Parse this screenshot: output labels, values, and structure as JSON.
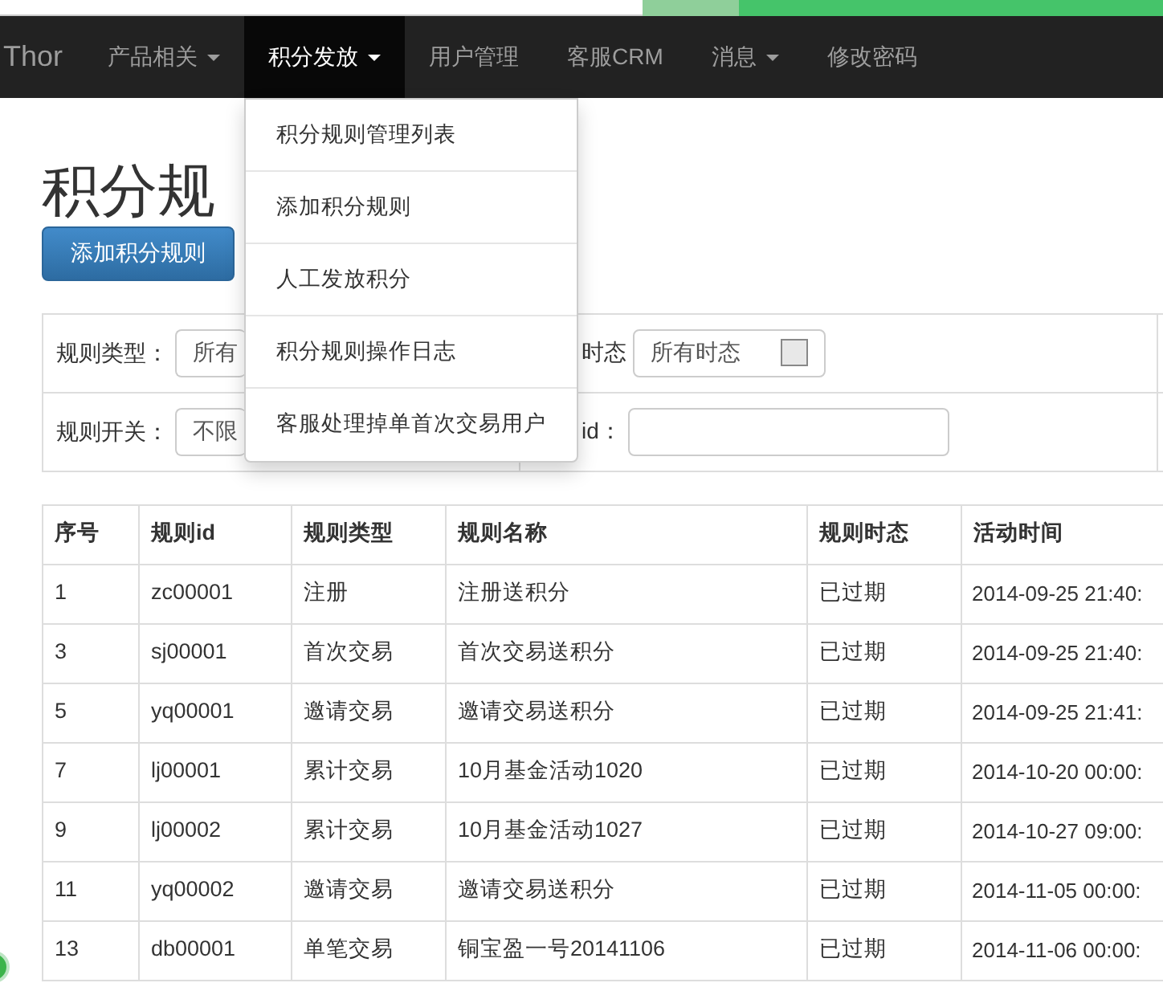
{
  "navbar": {
    "brand": "Thor",
    "items": [
      {
        "label": "产品相关",
        "has_caret": true,
        "selected": false
      },
      {
        "label": "积分发放",
        "has_caret": true,
        "selected": true
      },
      {
        "label": "用户管理",
        "has_caret": false,
        "selected": false
      },
      {
        "label": "客服CRM",
        "has_caret": false,
        "selected": false
      },
      {
        "label": "消息",
        "has_caret": true,
        "selected": false
      },
      {
        "label": "修改密码",
        "has_caret": false,
        "selected": false
      }
    ],
    "dropdown": {
      "items": [
        "积分规则管理列表",
        "添加积分规则",
        "人工发放积分",
        "积分规则操作日志",
        "客服处理掉单首次交易用户"
      ]
    }
  },
  "page_title": "积分规",
  "add_button": "添加积分规则",
  "filters": [
    [
      {
        "label": "规则类型：",
        "kind": "select",
        "value": "所有"
      },
      {
        "label": "时态",
        "kind": "select",
        "value": "所有时态"
      }
    ],
    [
      {
        "label": "规则开关：",
        "kind": "select",
        "value": "不限"
      },
      {
        "label": "id：",
        "kind": "input"
      }
    ]
  ],
  "table": {
    "columns": [
      "序号",
      "规则id",
      "规则类型",
      "规则名称",
      "规则时态",
      "活动时间"
    ],
    "rows": [
      [
        "1",
        "zc00001",
        "注册",
        "注册送积分",
        "已过期",
        "2014-09-25 21:40:"
      ],
      [
        "3",
        "sj00001",
        "首次交易",
        "首次交易送积分",
        "已过期",
        "2014-09-25 21:40:"
      ],
      [
        "5",
        "yq00001",
        "邀请交易",
        "邀请交易送积分",
        "已过期",
        "2014-09-25 21:41:"
      ],
      [
        "7",
        "lj00001",
        "累计交易",
        "10月基金活动1020",
        "已过期",
        "2014-10-20 00:00:"
      ],
      [
        "9",
        "lj00002",
        "累计交易",
        "10月基金活动1027",
        "已过期",
        "2014-10-27 09:00:"
      ],
      [
        "11",
        "yq00002",
        "邀请交易",
        "邀请交易送积分",
        "已过期",
        "2014-11-05 00:00:"
      ],
      [
        "13",
        "db00001",
        "单笔交易",
        "铜宝盈一号20141106",
        "已过期",
        "2014-11-06 00:00:"
      ]
    ]
  }
}
